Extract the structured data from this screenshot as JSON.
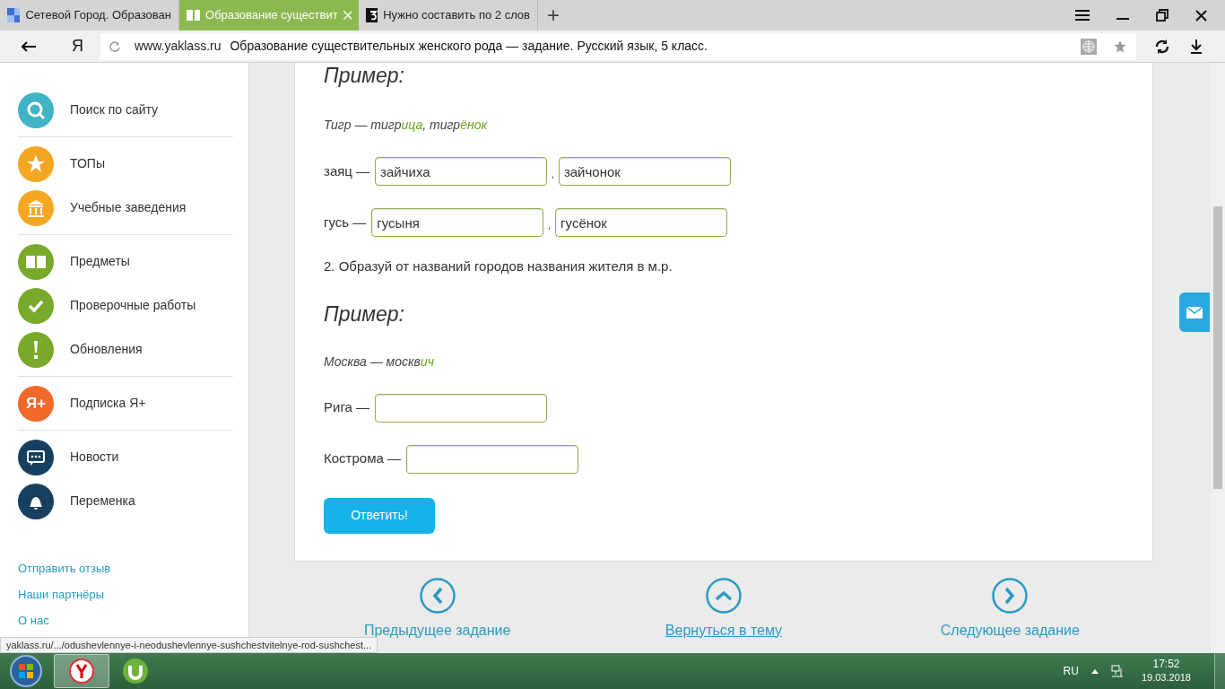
{
  "browser": {
    "tabs": [
      {
        "title": "Сетевой Город. Образован",
        "selected": false,
        "kind": "grid"
      },
      {
        "title": "Образование существит",
        "selected": true,
        "kind": "book"
      },
      {
        "title": "Нужно составить по 2 слов",
        "selected": false,
        "kind": "three"
      }
    ],
    "new_tab": "+",
    "logo": "Я",
    "address": {
      "domain": "www.yaklass.ru",
      "title": "Образование существительных женского рода — задание. Русский язык, 5 класс."
    }
  },
  "sidebar": {
    "groups": [
      [
        {
          "label": "Поиск по сайту",
          "kind": "search"
        }
      ],
      [
        {
          "label": "ТОПы",
          "kind": "star"
        },
        {
          "label": "Учебные заведения",
          "kind": "building"
        }
      ],
      [
        {
          "label": "Предметы",
          "kind": "book"
        },
        {
          "label": "Проверочные работы",
          "kind": "check"
        },
        {
          "label": "Обновления",
          "kind": "exclaim"
        }
      ],
      [
        {
          "label": "Подписка Я+",
          "kind": "yaplus",
          "icon_text": "Я+"
        }
      ],
      [
        {
          "label": "Новости",
          "kind": "chat"
        },
        {
          "label": "Переменка",
          "kind": "bell"
        }
      ]
    ],
    "links": [
      "Отправить отзыв",
      "Наши партнёры",
      "О нас"
    ]
  },
  "task": {
    "blocks": [
      {
        "kind": "heading",
        "text": "Пример:"
      },
      {
        "kind": "example",
        "parts": [
          {
            "text": "Тигр — тигр",
            "highlight": false
          },
          {
            "text": "ица",
            "highlight": true
          },
          {
            "text": ", тигр",
            "highlight": false
          },
          {
            "text": "ёнок",
            "highlight": true
          }
        ]
      },
      {
        "kind": "answer",
        "label": "заяц —",
        "fields": [
          {
            "value": "зайчиха"
          },
          {
            "value": "зайчонок"
          }
        ],
        "separator": ","
      },
      {
        "kind": "answer",
        "label": "гусь —",
        "fields": [
          {
            "value": "гусыня"
          },
          {
            "value": "гусёнок"
          }
        ],
        "separator": ","
      },
      {
        "kind": "instruction",
        "text": "2. Образуй от названий городов названия жителя в м.р."
      },
      {
        "kind": "heading",
        "text": "Пример:"
      },
      {
        "kind": "example",
        "parts": [
          {
            "text": "Москва — москв",
            "highlight": false
          },
          {
            "text": "ич",
            "highlight": true
          }
        ]
      },
      {
        "kind": "blank_answer",
        "label": "Рига —"
      },
      {
        "kind": "blank_answer",
        "label": "Кострома —"
      }
    ],
    "submit": "Ответить!"
  },
  "navigation": [
    {
      "label": "Предыдущее задание",
      "kind": "left",
      "underlined": false
    },
    {
      "label": "Вернуться в тему",
      "kind": "up",
      "underlined": true
    },
    {
      "label": "Следующее задание",
      "kind": "right",
      "underlined": false
    }
  ],
  "status_url": "yaklass.ru/.../odushevlennye-i-neodushevlennye-sushchestvitelnye-rod-sushchest...",
  "taskbar": {
    "language": "RU",
    "time": "17:52",
    "date": "19.03.2018"
  }
}
